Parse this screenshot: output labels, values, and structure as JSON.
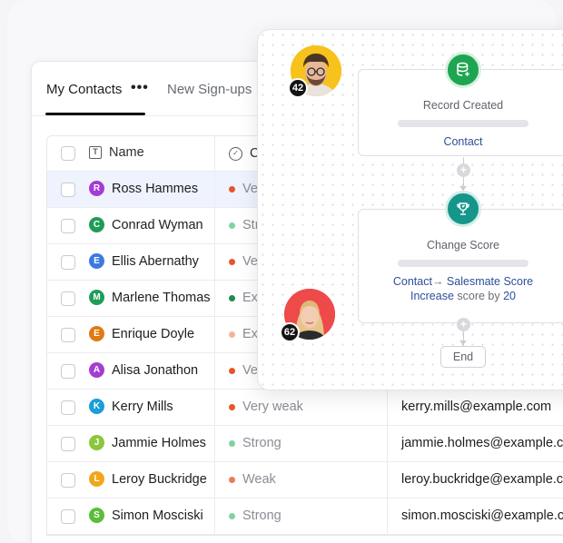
{
  "tabs": {
    "active": "My Contacts",
    "more": "•••",
    "inactive": "New Sign-ups"
  },
  "table": {
    "headers": {
      "name_icon": "T",
      "name": "Name",
      "status_icon": "✓",
      "status": "C"
    },
    "rows": [
      {
        "initial": "R",
        "name": "Ross Hammes",
        "avatar_color": "#a43dd2",
        "status": "Ve",
        "dot_color": "#e8542b",
        "email": "",
        "selected": true
      },
      {
        "initial": "C",
        "name": "Conrad Wyman",
        "avatar_color": "#1f9d57",
        "status": "Str",
        "dot_color": "#7fd39c",
        "email": ""
      },
      {
        "initial": "E",
        "name": "Ellis Abernathy",
        "avatar_color": "#3b7be0",
        "status": "Ve",
        "dot_color": "#e8542b",
        "email": ""
      },
      {
        "initial": "M",
        "name": "Marlene Thomas",
        "avatar_color": "#1f9d57",
        "status": "Ext",
        "dot_color": "#1f8a4c",
        "email": ""
      },
      {
        "initial": "E",
        "name": "Enrique Doyle",
        "avatar_color": "#e07b12",
        "status": "Ext",
        "dot_color": "#f5b29a",
        "email": ""
      },
      {
        "initial": "A",
        "name": "Alisa Jonathon",
        "avatar_color": "#a43dd2",
        "status": "Ve",
        "dot_color": "#e8542b",
        "email": ""
      },
      {
        "initial": "K",
        "name": "Kerry Mills",
        "avatar_color": "#1a9fd6",
        "status": "Very weak",
        "dot_color": "#e8542b",
        "email": "kerry.mills@example.com"
      },
      {
        "initial": "J",
        "name": "Jammie Holmes",
        "avatar_color": "#8cc63e",
        "status": "Strong",
        "dot_color": "#7fd39c",
        "email": "jammie.holmes@example.co"
      },
      {
        "initial": "L",
        "name": "Leroy Buckridge",
        "avatar_color": "#f0a81a",
        "status": "Weak",
        "dot_color": "#ee7a5a",
        "email": "leroy.buckridge@example.co"
      },
      {
        "initial": "S",
        "name": "Simon Mosciski",
        "avatar_color": "#5bbd3a",
        "status": "Strong",
        "dot_color": "#7fd39c",
        "email": "simon.mosciski@example.com"
      }
    ]
  },
  "workflow": {
    "node1": {
      "title": "Record Created",
      "link": "Contact",
      "icon": "database-plus-icon",
      "icon_color": "#1ea552"
    },
    "node2": {
      "title": "Change Score",
      "line1_a": "Contact",
      "line1_arrow": "→",
      "line1_b": " Salesmate Score",
      "line2_a": "Increase",
      "line2_b": " score by ",
      "line2_c": "20",
      "icon": "trophy-icon",
      "icon_color": "#16968a"
    },
    "plus1": "+",
    "plus2": "+",
    "end": "End"
  },
  "people": [
    {
      "badge": "42",
      "bg": "#f6c21b"
    },
    {
      "badge": "62",
      "bg": "#ee4a4a"
    }
  ]
}
